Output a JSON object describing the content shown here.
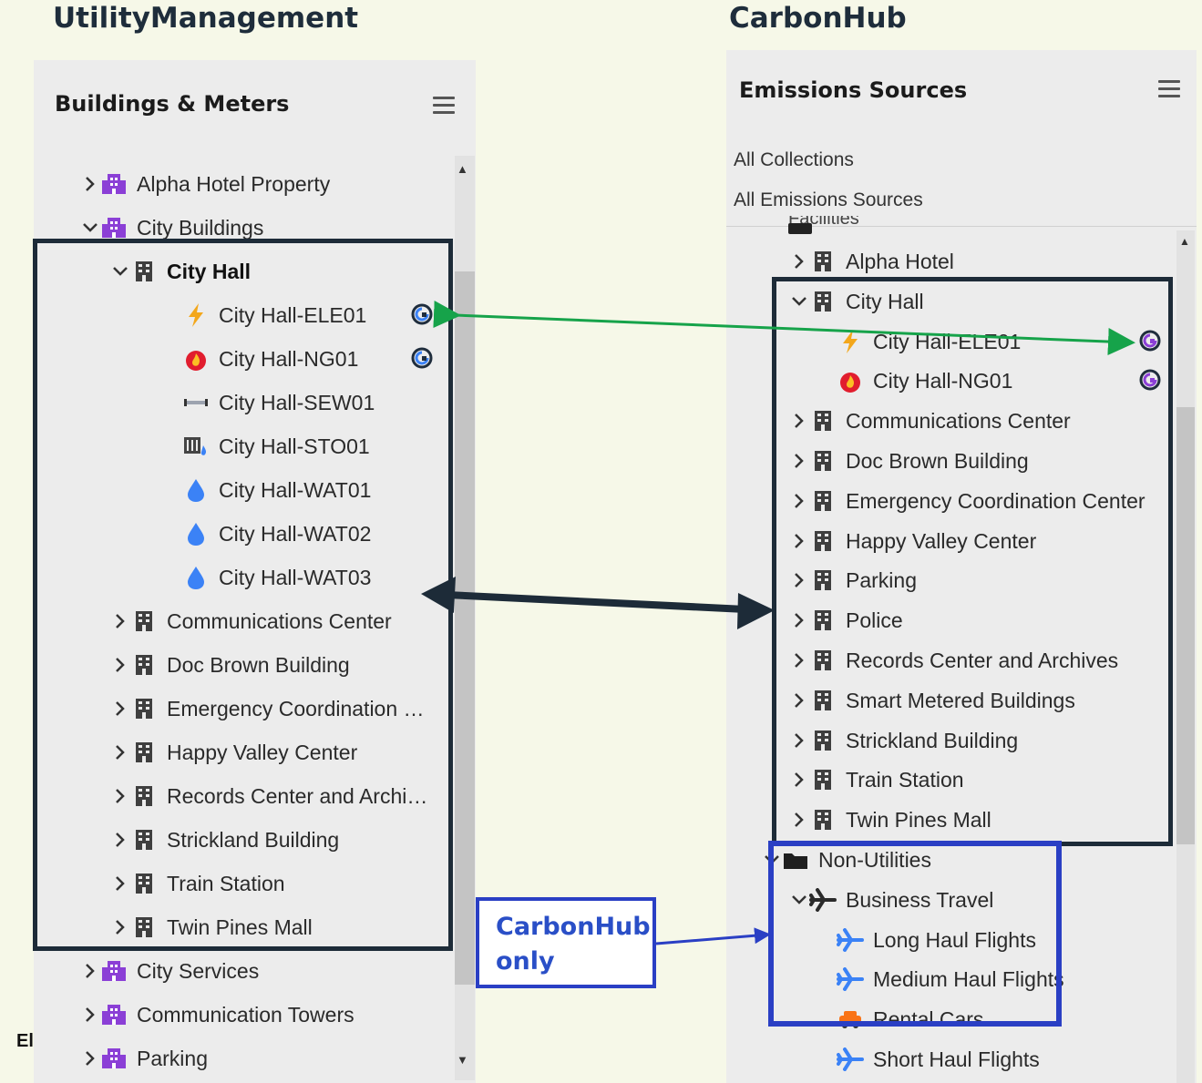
{
  "titles": {
    "left": "UtilityManagement",
    "right": "CarbonHub"
  },
  "left_panel": {
    "header": "Buildings & Meters",
    "items": [
      {
        "label": "Alpha Hotel Property",
        "icon": "building-group-icon",
        "chevron": "right"
      },
      {
        "label": "City Buildings",
        "icon": "building-group-icon",
        "chevron": "down"
      },
      {
        "label": "City Hall",
        "icon": "building-icon",
        "chevron": "down"
      },
      {
        "label": "City Hall-ELE01",
        "icon": "electric-icon",
        "badge": "carbonhub-link-icon"
      },
      {
        "label": "City Hall-NG01",
        "icon": "gas-flame-icon",
        "badge": "carbonhub-link-icon"
      },
      {
        "label": "City Hall-SEW01",
        "icon": "sewer-pipe-icon"
      },
      {
        "label": "City Hall-STO01",
        "icon": "storm-water-icon"
      },
      {
        "label": "City Hall-WAT01",
        "icon": "water-drop-icon"
      },
      {
        "label": "City Hall-WAT02",
        "icon": "water-drop-icon"
      },
      {
        "label": "City Hall-WAT03",
        "icon": "water-drop-icon"
      },
      {
        "label": "Communications Center",
        "icon": "building-icon",
        "chevron": "right"
      },
      {
        "label": "Doc Brown Building",
        "icon": "building-icon",
        "chevron": "right"
      },
      {
        "label": "Emergency Coordination …",
        "icon": "building-icon",
        "chevron": "right"
      },
      {
        "label": "Happy Valley Center",
        "icon": "building-icon",
        "chevron": "right"
      },
      {
        "label": "Records Center and Archi…",
        "icon": "building-icon",
        "chevron": "right"
      },
      {
        "label": "Strickland Building",
        "icon": "building-icon",
        "chevron": "right"
      },
      {
        "label": "Train Station",
        "icon": "building-icon",
        "chevron": "right"
      },
      {
        "label": "Twin Pines Mall",
        "icon": "building-icon",
        "chevron": "right"
      },
      {
        "label": "City Services",
        "icon": "building-group-icon",
        "chevron": "right"
      },
      {
        "label": "Communication Towers",
        "icon": "building-group-icon",
        "chevron": "right"
      },
      {
        "label": "Parking",
        "icon": "building-group-icon",
        "chevron": "right"
      }
    ],
    "footer_fragment": "El"
  },
  "right_panel": {
    "header": "Emissions Sources",
    "filters": [
      "All Collections",
      "All Emissions Sources"
    ],
    "partial_label": "Facilities",
    "items": [
      {
        "label": "Alpha Hotel",
        "icon": "building-icon",
        "chevron": "right"
      },
      {
        "label": "City Hall",
        "icon": "building-icon",
        "chevron": "down"
      },
      {
        "label": "City Hall-ELE01",
        "icon": "electric-icon",
        "badge": "utility-link-icon"
      },
      {
        "label": "City Hall-NG01",
        "icon": "gas-flame-icon",
        "badge": "utility-link-icon"
      },
      {
        "label": "Communications Center",
        "icon": "building-icon",
        "chevron": "right"
      },
      {
        "label": "Doc Brown Building",
        "icon": "building-icon",
        "chevron": "right"
      },
      {
        "label": "Emergency Coordination Center",
        "icon": "building-icon",
        "chevron": "right"
      },
      {
        "label": "Happy Valley Center",
        "icon": "building-icon",
        "chevron": "right"
      },
      {
        "label": "Parking",
        "icon": "building-icon",
        "chevron": "right"
      },
      {
        "label": "Police",
        "icon": "building-icon",
        "chevron": "right"
      },
      {
        "label": "Records Center and Archives",
        "icon": "building-icon",
        "chevron": "right"
      },
      {
        "label": "Smart Metered Buildings",
        "icon": "building-icon",
        "chevron": "right"
      },
      {
        "label": "Strickland Building",
        "icon": "building-icon",
        "chevron": "right"
      },
      {
        "label": "Train Station",
        "icon": "building-icon",
        "chevron": "right"
      },
      {
        "label": "Twin Pines Mall",
        "icon": "building-icon",
        "chevron": "right"
      },
      {
        "label": "Non-Utilities",
        "icon": "folder-icon",
        "chevron": "down"
      },
      {
        "label": "Business Travel",
        "icon": "airplane-icon",
        "chevron": "down"
      },
      {
        "label": "Long Haul Flights",
        "icon": "airplane-icon"
      },
      {
        "label": "Medium Haul Flights",
        "icon": "airplane-icon"
      },
      {
        "label": "Rental Cars",
        "icon": "car-icon"
      },
      {
        "label": "Short Haul Flights",
        "icon": "airplane-icon"
      }
    ]
  },
  "callout": {
    "text": "CarbonHub only"
  },
  "colors": {
    "dark_box": "#1d2b38",
    "blue_box": "#2a3fc4",
    "green_arrow": "#16a34a",
    "group_icon": "#8b3fd6"
  }
}
